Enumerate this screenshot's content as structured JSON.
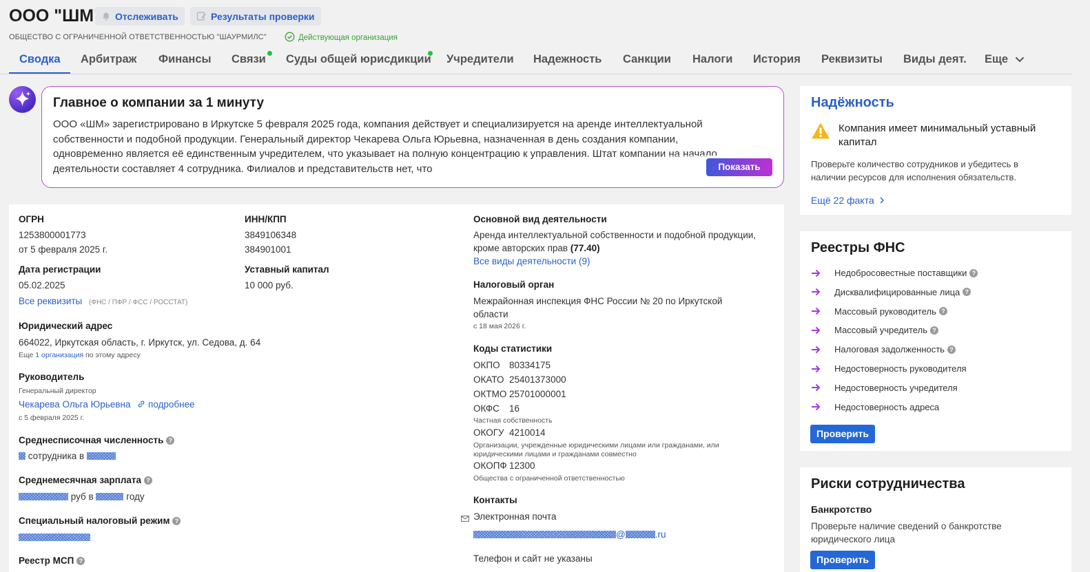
{
  "header": {
    "title": "ООО \"ШМ\"",
    "track_label": "Отслеживать",
    "results_label": "Результаты проверки",
    "legal_name": "ОБЩЕСТВО С ОГРАНИЧЕННОЙ ОТВЕТСТВЕННОСТЬЮ \"ШАУРМИЛС\"",
    "status": "Действующая организация"
  },
  "tabs": [
    {
      "label": "Сводка",
      "active": true
    },
    {
      "label": "Арбитраж"
    },
    {
      "label": "Финансы"
    },
    {
      "label": "Связи",
      "dot": true
    },
    {
      "label": "Суды общей юрисдикции",
      "dot": true
    },
    {
      "label": "Учредители"
    },
    {
      "label": "Надежность"
    },
    {
      "label": "Санкции"
    },
    {
      "label": "Налоги"
    },
    {
      "label": "История"
    },
    {
      "label": "Реквизиты"
    },
    {
      "label": "Виды деят."
    },
    {
      "label": "Еще"
    }
  ],
  "summary": {
    "title": "Главное о компании за 1 минуту",
    "text": "ООО «ШМ» зарегистрировано в Иркутске 5 февраля 2025 года, компания действует и специализируется на аренде интеллектуальной собственности и подобной продукции. Генеральный директор Чекарева Ольга Юрьевна, назначенная в день создания компании, одновременно является её единственным учредителем, что указывает на полную концентрацию к управления. Штат компании на начало деятельности составляет 4 сотрудника. Филиалов и представительств нет, что",
    "show_label": "Показать"
  },
  "details": {
    "ogrn_label": "ОГРН",
    "ogrn": "1253800001773",
    "ogrn_date": "от 5 февраля 2025 г.",
    "inn_label": "ИНН/КПП",
    "inn": "3849106348",
    "kpp": "384901001",
    "reg_label": "Дата регистрации",
    "reg_date": "05.02.2025",
    "capital_label": "Уставный капитал",
    "capital": "10 000 руб.",
    "all_req_link": "Все реквизиты",
    "all_req_note": "(ФНС / ПФР / ФСС / РОССТАТ)",
    "address_label": "Юридический адрес",
    "address": "664022, Иркутская область, г. Иркутск, ул. Седова, д. 64",
    "address_more_prefix": "Еще",
    "address_more_link": "1 организация",
    "address_more_suffix": "по этому адресу",
    "head_label": "Руководитель",
    "head_position": "Генеральный директор",
    "head_name": "Чекарева Ольга Юрьевна",
    "head_more": "подробнее",
    "head_since": "с 5 февраля 2025 г.",
    "staff_label": "Среднесписочная численность",
    "staff_mid": "сотрудника в",
    "salary_label": "Среднемесячная зарплата",
    "salary_mid": "руб в",
    "salary_end": "году",
    "tax_regime_label": "Специальный налоговый режим",
    "msp_label": "Реестр МСП",
    "activity_label": "Основной вид деятельности",
    "activity_line1": "Аренда интеллектуальной собственности и подобной продукции,",
    "activity_line2": "кроме авторских прав",
    "activity_code": "(77.40)",
    "activity_all": "Все виды деятельности (9)",
    "tax_label": "Налоговый орган",
    "tax_line1": "Межрайонная инспекция ФНС России № 20 по Иркутской",
    "tax_line2": "области",
    "tax_since": "с 18 мая 2026 г.",
    "stats_label": "Коды статистики",
    "okpo_k": "ОКПО",
    "okpo_v": "80334175",
    "okato_k": "ОКАТО",
    "okato_v": "25401373000",
    "oktmo_k": "ОКТМО",
    "oktmo_v": "25701000001",
    "okfs_k": "ОКФС",
    "okfs_v": "16",
    "okfs_note": "Частная собственность",
    "okogu_k": "ОКОГУ",
    "okogu_v": "4210014",
    "okogu_note1": "Организации, учрежденные юридическими лицами или гражданами, или",
    "okogu_note2": "юридическими лицами и гражданами совместно",
    "okopf_k": "ОКОПФ",
    "okopf_v": "12300",
    "okopf_note": "Общества с ограниченной ответственностью",
    "contacts_label": "Контакты",
    "email_label": "Электронная почта",
    "email_at": "@",
    "email_tld": ".ru",
    "phone_note": "Телефон и сайт не указаны"
  },
  "reliability": {
    "title": "Надёжность",
    "warning_line1": "Компания имеет минимальный уставный",
    "warning_line2": "капитал",
    "hint_line1": "Проверьте количество сотрудников и убедитесь в",
    "hint_line2": "наличии ресурсов для исполнения обязательств.",
    "more_link": "Ещё 22 факта"
  },
  "fns": {
    "title": "Реестры ФНС",
    "items": [
      {
        "label": "Недобросовестные поставщики",
        "help": true
      },
      {
        "label": "Дисквалифицированные лица",
        "help": true
      },
      {
        "label": "Массовый руководитель",
        "help": true
      },
      {
        "label": "Массовый учредитель",
        "help": true
      },
      {
        "label": "Налоговая задолженность",
        "help": true
      },
      {
        "label": "Недостоверность руководителя"
      },
      {
        "label": "Недостоверность учредителя"
      },
      {
        "label": "Недостоверность адреса"
      }
    ],
    "check_label": "Проверить"
  },
  "risks": {
    "title": "Риски сотрудничества",
    "bankruptcy_label": "Банкротство",
    "bankruptcy_line1": "Проверьте наличие сведений о банкротстве",
    "bankruptcy_line2": "юридического лица",
    "check_label": "Проверить"
  },
  "colors": {
    "accent": "#2a5fc8",
    "active_status": "#39a135",
    "ai_gradient_start": "#3e58dc",
    "ai_gradient_end": "#c02fd2",
    "button_blue": "#2468d8",
    "warning": "#f2b71c",
    "registry_arrow": "#a43be0"
  }
}
